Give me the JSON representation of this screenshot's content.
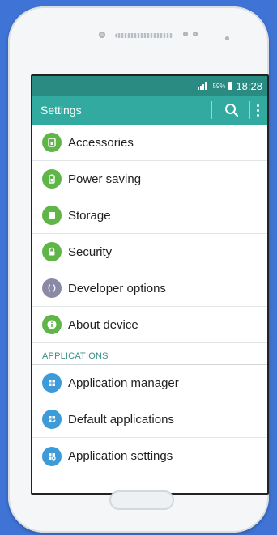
{
  "status_bar": {
    "battery_percent": "59%",
    "time": "18:28"
  },
  "app_bar": {
    "title": "Settings"
  },
  "items_top": [
    {
      "label": "Accessories",
      "icon": "accessories-icon",
      "color": "#5fb548"
    },
    {
      "label": "Power saving",
      "icon": "battery-icon",
      "color": "#5fb548"
    },
    {
      "label": "Storage",
      "icon": "storage-icon",
      "color": "#5fb548"
    },
    {
      "label": "Security",
      "icon": "lock-icon",
      "color": "#5fb548"
    },
    {
      "label": "Developer options",
      "icon": "braces-icon",
      "color": "#8a8aa6"
    },
    {
      "label": "About device",
      "icon": "info-icon",
      "color": "#5fb548"
    }
  ],
  "section_header": "APPLICATIONS",
  "items_apps": [
    {
      "label": "Application manager",
      "icon": "grid-icon",
      "color": "#3c9bd8"
    },
    {
      "label": "Default applications",
      "icon": "grid-check-icon",
      "color": "#3c9bd8"
    },
    {
      "label": "Application settings",
      "icon": "grid-settings-icon",
      "color": "#3c9bd8"
    }
  ]
}
